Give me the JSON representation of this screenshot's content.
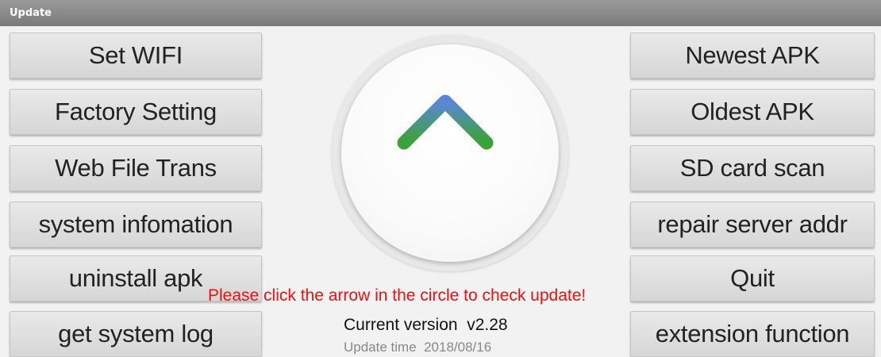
{
  "window": {
    "title": "Update"
  },
  "left_buttons": [
    {
      "label": "Set WIFI"
    },
    {
      "label": "Factory Setting"
    },
    {
      "label": "Web File Trans"
    },
    {
      "label": "system infomation"
    },
    {
      "label": "uninstall apk"
    },
    {
      "label": "get system log"
    }
  ],
  "right_buttons": [
    {
      "label": "Newest APK"
    },
    {
      "label": "Oldest APK"
    },
    {
      "label": "SD card scan"
    },
    {
      "label": "repair server addr"
    },
    {
      "label": "Quit"
    },
    {
      "label": "extension function"
    }
  ],
  "center": {
    "icon": "up-arrow-icon",
    "hint": "Please click the arrow in the circle to check update!",
    "version": "Current version  v2.28",
    "update_time": "Update time  2018/08/16"
  },
  "colors": {
    "arrow_top": "#5b86d8",
    "arrow_bottom": "#3aa333",
    "hint": "#ee1111"
  }
}
